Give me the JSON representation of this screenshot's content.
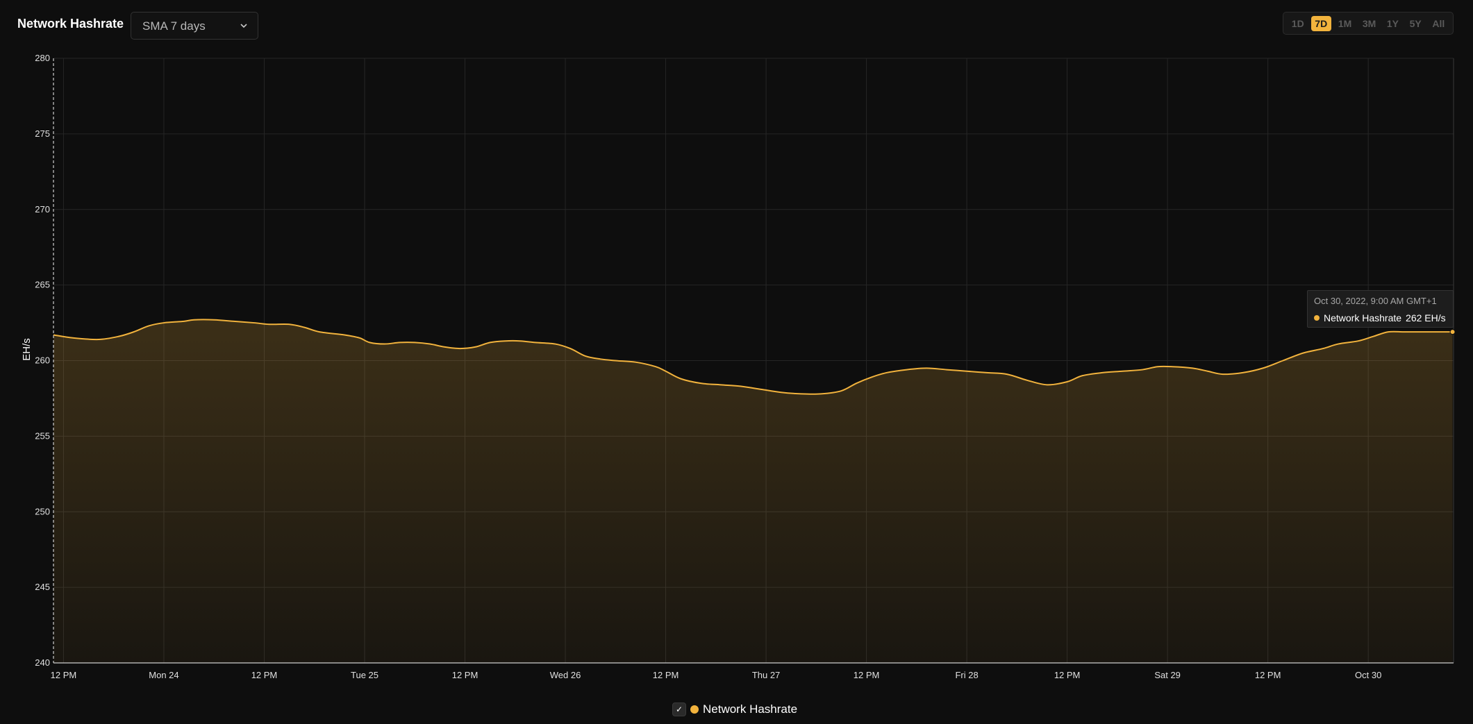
{
  "header": {
    "title": "Network Hashrate",
    "select_value": "SMA 7 days"
  },
  "ranges": [
    {
      "label": "1D",
      "active": false
    },
    {
      "label": "7D",
      "active": true
    },
    {
      "label": "1M",
      "active": false
    },
    {
      "label": "3M",
      "active": false
    },
    {
      "label": "1Y",
      "active": false
    },
    {
      "label": "5Y",
      "active": false
    },
    {
      "label": "All",
      "active": false
    }
  ],
  "icons": {
    "select": "chevron-down-icon",
    "legend_check": "checkmark-icon"
  },
  "colors": {
    "background": "#0e0e0e",
    "accent": "#f2b33d",
    "grid": "#262626",
    "tick_text": "#e0e0e0"
  },
  "legend": {
    "checked": true,
    "label": "Network Hashrate"
  },
  "tooltip": {
    "date": "Oct 30, 2022, 9:00 AM GMT+1",
    "series": "Network Hashrate",
    "value_text": "262 EH/s"
  },
  "chart_data": {
    "type": "area",
    "ylabel": "EH/s",
    "ylim": [
      240,
      280
    ],
    "yticks": [
      240,
      245,
      250,
      255,
      260,
      265,
      270,
      275,
      280
    ],
    "xlim_hours": [
      -22,
      257
    ],
    "xticks": [
      {
        "hour": -20,
        "label": "12 PM"
      },
      {
        "hour": 0,
        "label": "Mon 24"
      },
      {
        "hour": 20,
        "label": "12 PM"
      },
      {
        "hour": 40,
        "label": "Tue 25"
      },
      {
        "hour": 60,
        "label": "12 PM"
      },
      {
        "hour": 80,
        "label": "Wed 26"
      },
      {
        "hour": 100,
        "label": "12 PM"
      },
      {
        "hour": 120,
        "label": "Thu 27"
      },
      {
        "hour": 140,
        "label": "12 PM"
      },
      {
        "hour": 160,
        "label": "Fri 28"
      },
      {
        "hour": 180,
        "label": "12 PM"
      },
      {
        "hour": 200,
        "label": "Sat 29"
      },
      {
        "hour": 220,
        "label": "12 PM"
      },
      {
        "hour": 240,
        "label": "Oct 30"
      }
    ],
    "grid": true,
    "legend_position": "bottom-center",
    "series": [
      {
        "name": "Network Hashrate",
        "points": [
          [
            -22,
            261.7
          ],
          [
            -18,
            261.5
          ],
          [
            -13,
            261.4
          ],
          [
            -9,
            261.6
          ],
          [
            -6,
            261.9
          ],
          [
            -3,
            262.3
          ],
          [
            0,
            262.5
          ],
          [
            4,
            262.6
          ],
          [
            6,
            262.7
          ],
          [
            10,
            262.7
          ],
          [
            14,
            262.6
          ],
          [
            18,
            262.5
          ],
          [
            21,
            262.4
          ],
          [
            25,
            262.4
          ],
          [
            28,
            262.2
          ],
          [
            31,
            261.9
          ],
          [
            36,
            261.7
          ],
          [
            39,
            261.5
          ],
          [
            41,
            261.2
          ],
          [
            44,
            261.1
          ],
          [
            47,
            261.2
          ],
          [
            50,
            261.2
          ],
          [
            53,
            261.1
          ],
          [
            56,
            260.9
          ],
          [
            59,
            260.8
          ],
          [
            62,
            260.9
          ],
          [
            65,
            261.2
          ],
          [
            68,
            261.3
          ],
          [
            71,
            261.3
          ],
          [
            74,
            261.2
          ],
          [
            78,
            261.1
          ],
          [
            81,
            260.8
          ],
          [
            84,
            260.3
          ],
          [
            87,
            260.1
          ],
          [
            90,
            260.0
          ],
          [
            94,
            259.9
          ],
          [
            98,
            259.6
          ],
          [
            100,
            259.3
          ],
          [
            103,
            258.8
          ],
          [
            107,
            258.5
          ],
          [
            111,
            258.4
          ],
          [
            115,
            258.3
          ],
          [
            119,
            258.1
          ],
          [
            123,
            257.9
          ],
          [
            127,
            257.8
          ],
          [
            131,
            257.8
          ],
          [
            135,
            258.0
          ],
          [
            138,
            258.5
          ],
          [
            141,
            258.9
          ],
          [
            144,
            259.2
          ],
          [
            148,
            259.4
          ],
          [
            152,
            259.5
          ],
          [
            156,
            259.4
          ],
          [
            160,
            259.3
          ],
          [
            164,
            259.2
          ],
          [
            168,
            259.1
          ],
          [
            172,
            258.7
          ],
          [
            176,
            258.4
          ],
          [
            180,
            258.6
          ],
          [
            183,
            259.0
          ],
          [
            187,
            259.2
          ],
          [
            191,
            259.3
          ],
          [
            195,
            259.4
          ],
          [
            198,
            259.6
          ],
          [
            201,
            259.6
          ],
          [
            205,
            259.5
          ],
          [
            208,
            259.3
          ],
          [
            211,
            259.1
          ],
          [
            215,
            259.2
          ],
          [
            219,
            259.5
          ],
          [
            223,
            260.0
          ],
          [
            227,
            260.5
          ],
          [
            231,
            260.8
          ],
          [
            234,
            261.1
          ],
          [
            238,
            261.3
          ],
          [
            241,
            261.6
          ],
          [
            244,
            261.9
          ],
          [
            247,
            261.9
          ],
          [
            250,
            261.9
          ],
          [
            253,
            261.9
          ],
          [
            256.8,
            261.9
          ]
        ]
      }
    ]
  }
}
